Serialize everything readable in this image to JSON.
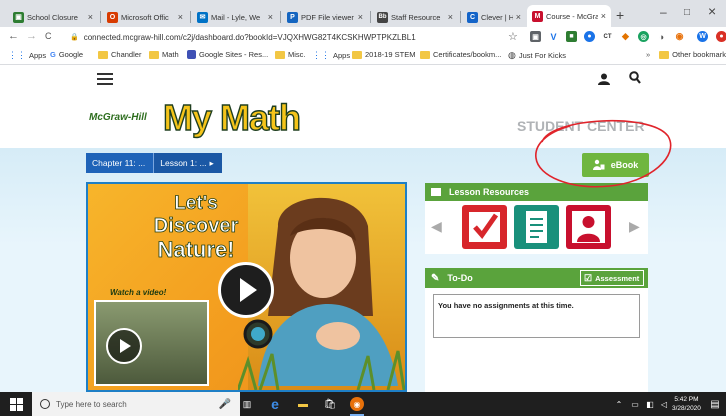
{
  "browser": {
    "tabs": [
      {
        "title": "School Closure",
        "favicon_color": "#2e7d32",
        "favicon_glyph": "▣"
      },
      {
        "title": "Microsoft Offic",
        "favicon_color": "#d83b01",
        "favicon_glyph": "O"
      },
      {
        "title": "Mail - Lyle, We",
        "favicon_color": "#0072c6",
        "favicon_glyph": "✉"
      },
      {
        "title": "PDF File viewer",
        "favicon_color": "#1565c0",
        "favicon_glyph": "P"
      },
      {
        "title": "Staff Resource",
        "favicon_color": "#444444",
        "favicon_glyph": "Bb"
      },
      {
        "title": "Clever | Home",
        "favicon_color": "#1464c8",
        "favicon_glyph": "C"
      },
      {
        "title": "Course - McGra",
        "favicon_color": "#c8102e",
        "favicon_glyph": "M"
      }
    ],
    "new_tab_symbol": "+",
    "window_controls": {
      "minimize": "–",
      "maximize": "□",
      "close": "×"
    },
    "nav": {
      "back": "←",
      "forward": "→",
      "reload": "C"
    },
    "url": "connected.mcgraw-hill.com/c2j/dashboard.do?bookId=VJQXHWG82T4KCSKHWPTPKZLBL1",
    "bookmarks": [
      {
        "label": "Apps",
        "kind": "apps"
      },
      {
        "label": "Google",
        "kind": "google"
      },
      {
        "label": "Chandler",
        "kind": "folder"
      },
      {
        "label": "Math",
        "kind": "folder"
      },
      {
        "label": "Google Sites - Res...",
        "kind": "site"
      },
      {
        "label": "Misc.",
        "kind": "folder"
      },
      {
        "label": "Apps",
        "kind": "apps"
      },
      {
        "label": "2018-19 STEM",
        "kind": "folder"
      },
      {
        "label": "Certificates/bookm...",
        "kind": "folder"
      },
      {
        "label": "Just For Kicks",
        "kind": "site"
      }
    ],
    "other_bookmarks": "Other bookmarks"
  },
  "site": {
    "publisher": "McGraw-Hill",
    "product": "My Math",
    "section": "STUDENT CENTER",
    "breadcrumb": {
      "chapter": "Chapter 11: ...",
      "lesson": "Lesson 1: ..."
    },
    "ebook_label": "eBook",
    "hero": {
      "title_lines": [
        "Let's",
        "Discover",
        "Nature!"
      ],
      "video_label": "Watch a video!"
    },
    "lesson_resources": {
      "title": "Lesson Resources",
      "items": [
        {
          "name": "check",
          "color": "#d7262b"
        },
        {
          "name": "worksheet",
          "color": "#19907b"
        },
        {
          "name": "profile",
          "color": "#c8102e"
        }
      ]
    },
    "todo": {
      "title": "To-Do",
      "assessment_label": "Assessment",
      "empty_message": "You have no assignments at this time."
    }
  },
  "taskbar": {
    "search_placeholder": "Type here to search",
    "time": "5:42 PM",
    "date": "3/28/2020"
  },
  "colors": {
    "brand_green": "#6fb63f",
    "panel_green": "#5aa33c",
    "crumb_blue": "#1f63b8",
    "annotation_red": "#e0242b"
  }
}
